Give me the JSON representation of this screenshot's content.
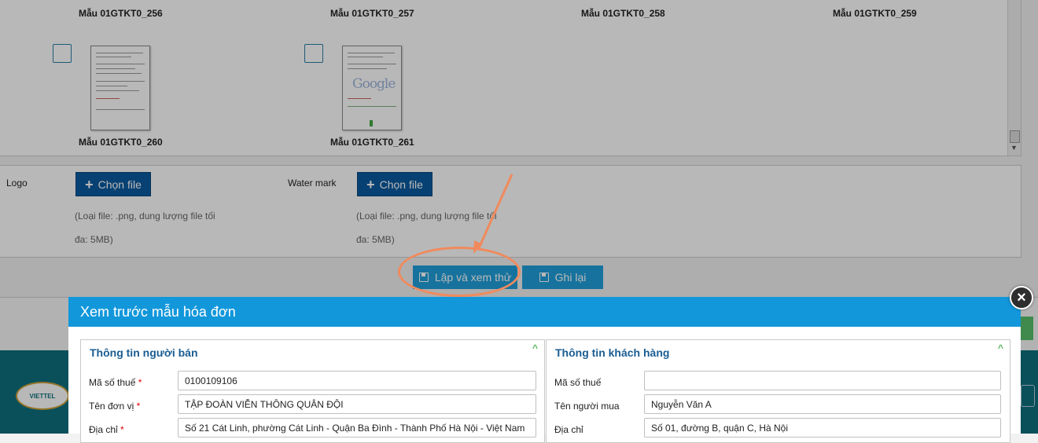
{
  "templates": [
    {
      "label": "Mẫu 01GTKT0_256"
    },
    {
      "label": "Mẫu 01GTKT0_257"
    },
    {
      "label": "Mẫu 01GTKT0_258"
    },
    {
      "label": "Mẫu 01GTKT0_259"
    },
    {
      "label": "Mẫu 01GTKT0_260"
    },
    {
      "label": "Mẫu 01GTKT0_261"
    }
  ],
  "upload": {
    "logo_label": "Logo",
    "watermark_label": "Water mark",
    "choose_file": "Chọn file",
    "hint_line1": "(Loại file: .png, dung lượng file tối",
    "hint_line2": "đa: 5MB)"
  },
  "actions": {
    "preview_label": "Lập và xem thử",
    "save_label": "Ghi lại"
  },
  "footer": {
    "logo_text": "VIETTEL"
  },
  "modal": {
    "title": "Xem trước mẫu hóa đơn",
    "close_icon": "×",
    "seller": {
      "title": "Thông tin người bán",
      "tax_code_label": "Mã số thuế",
      "tax_code_value": "0100109106",
      "unit_name_label": "Tên đơn vị",
      "unit_name_value": "TẬP ĐOÀN VIỄN THÔNG QUÂN ĐỘI",
      "address_label": "Địa chỉ",
      "address_value": "Số 21 Cát Linh, phường Cát Linh - Quận Ba Đình - Thành Phố Hà Nội - Việt Nam"
    },
    "buyer": {
      "title": "Thông tin khách hàng",
      "tax_code_label": "Mã số thuế",
      "tax_code_value": "",
      "buyer_name_label": "Tên người mua",
      "buyer_name_value": "Nguyễn Văn A",
      "address_label": "Địa chỉ",
      "address_value": "Số 01, đường B, quận C, Hà Nội"
    }
  },
  "annotation_color": "#f08a5d",
  "accent_color": "#1297db"
}
